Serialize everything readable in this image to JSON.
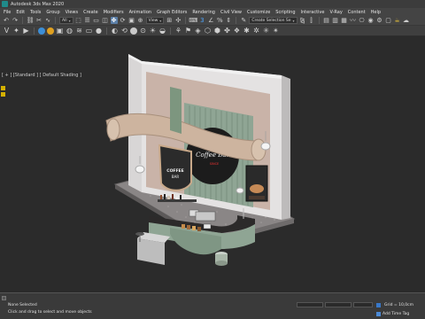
{
  "window": {
    "title": "Autodesk 3ds Max 2020"
  },
  "menu": [
    "File",
    "Edit",
    "Tools",
    "Group",
    "Views",
    "Create",
    "Modifiers",
    "Animation",
    "Graph Editors",
    "Rendering",
    "Civil View",
    "Customize",
    "Scripting",
    "Interactive",
    "V-Ray",
    "Content",
    "Help"
  ],
  "toolbar": {
    "filter_dropdown": "View",
    "selection_set_dropdown": "Create Selection Se"
  },
  "viewport": {
    "label": "[ + ] [Standard ] [ Default Shading ]"
  },
  "scene": {
    "sign_text_1": "COFFEE",
    "sign_text_2": "BAR",
    "wall_sign_text": "Coffee Bar",
    "wall_sign_sub": "SINCE"
  },
  "statusbar": {
    "selected": "None Selected",
    "prompt": "Click and drag to select and move objects",
    "grid": "Grid = 10,0cm",
    "add_time_tag": "Add Time Tag"
  },
  "colors": {
    "background": "#2b2b2b",
    "ui_panel": "#444444",
    "accent_blue": "#4ea6ff",
    "wall_green": "#8fa594",
    "floor": "#8a8686"
  }
}
